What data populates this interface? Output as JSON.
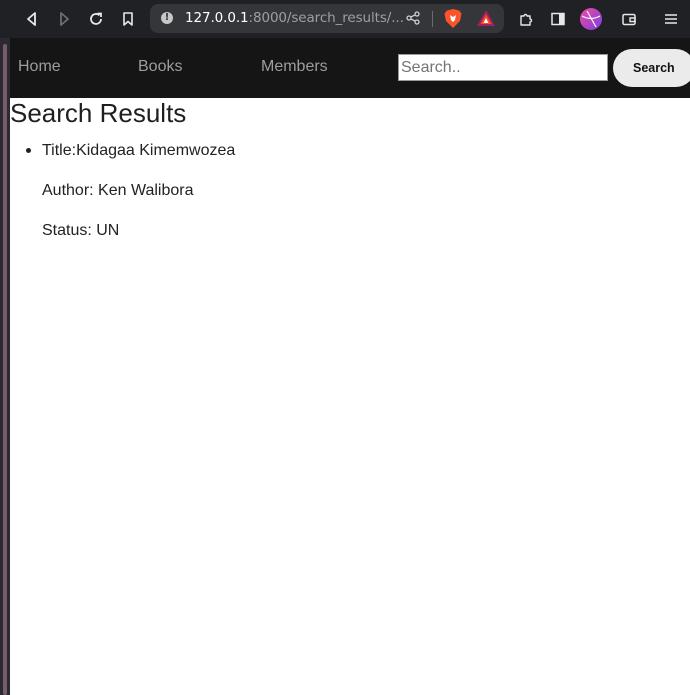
{
  "browser": {
    "url_host": "127.0.0.1",
    "url_rest": ":8000/search_results/..."
  },
  "nav": {
    "items": [
      {
        "label": "Home"
      },
      {
        "label": "Books"
      },
      {
        "label": "Members"
      }
    ],
    "search_placeholder": "Search..",
    "search_button_label": "Search"
  },
  "main": {
    "title": "Search Results",
    "results": [
      {
        "title_line": "Title:Kidagaa Kimemwozea",
        "author_line": "Author: Ken Walibora",
        "status_line": "Status: UN"
      }
    ]
  },
  "colors": {
    "navbar_bg": "#151515",
    "nav_link": "#9d9d9d",
    "browser_chrome": "#202124"
  }
}
